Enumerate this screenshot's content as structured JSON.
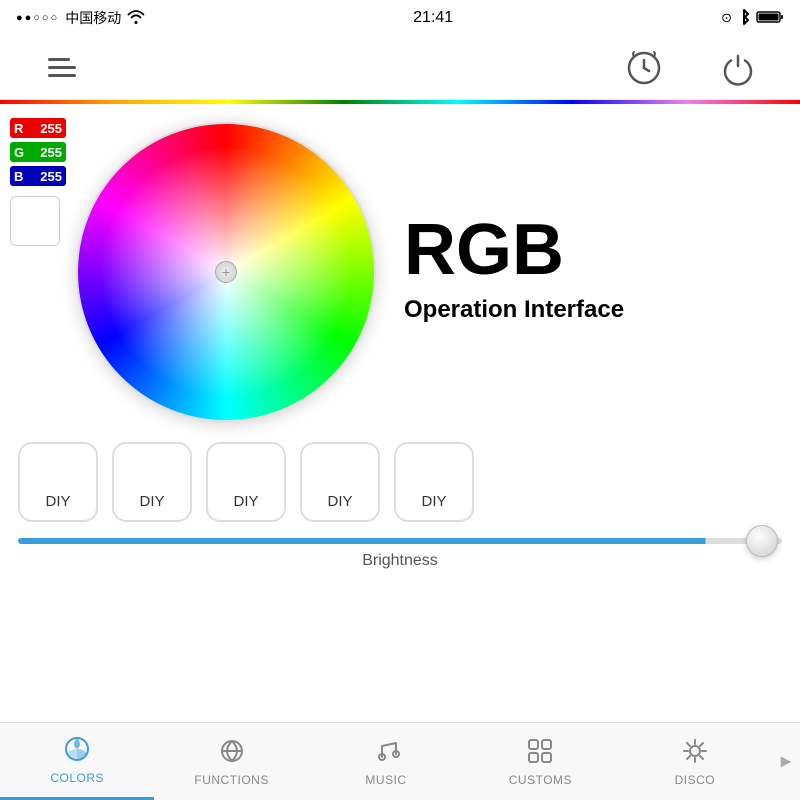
{
  "status_bar": {
    "signal": "●●○○○",
    "carrier": "中国移动",
    "wifi": "▲",
    "time": "21:41",
    "lock": "⊙",
    "bluetooth": "✦",
    "battery": "▮▮▮▮"
  },
  "top_nav": {
    "menu_label": "Menu",
    "clock_label": "Clock",
    "power_label": "Power"
  },
  "rgb_values": {
    "r_label": "R",
    "r_value": "255",
    "g_label": "G",
    "g_value": "255",
    "b_label": "B",
    "b_value": "255"
  },
  "main_title": "RGB",
  "main_subtitle": "Operation Interface",
  "diy_buttons": [
    {
      "label": "DIY"
    },
    {
      "label": "DIY"
    },
    {
      "label": "DIY"
    },
    {
      "label": "DIY"
    },
    {
      "label": "DIY"
    }
  ],
  "brightness": {
    "label": "Brightness"
  },
  "tabs": [
    {
      "id": "colors",
      "label": "COLORS",
      "active": true
    },
    {
      "id": "functions",
      "label": "FUNCTIONS",
      "active": false
    },
    {
      "id": "music",
      "label": "MUSIC",
      "active": false
    },
    {
      "id": "customs",
      "label": "CUSTOMS",
      "active": false
    },
    {
      "id": "disco",
      "label": "DISCO",
      "active": false
    }
  ]
}
